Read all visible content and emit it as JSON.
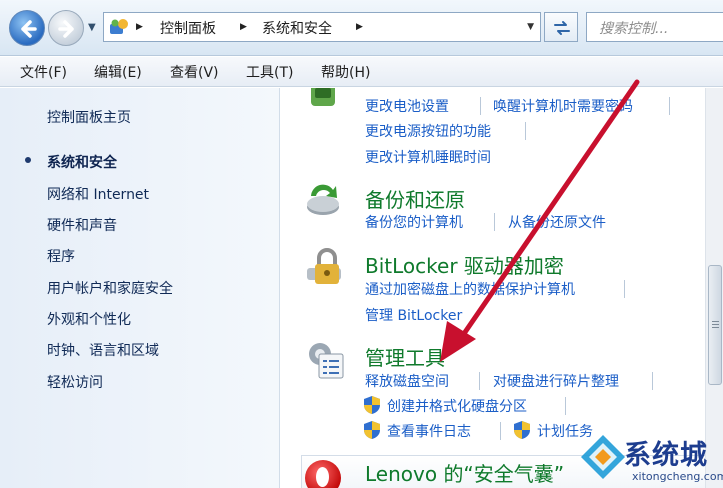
{
  "address_bar": {
    "breadcrumbs": [
      "控制面板",
      "系统和安全"
    ],
    "search_placeholder": "搜索控制..."
  },
  "menubar": [
    "文件(F)",
    "编辑(E)",
    "查看(V)",
    "工具(T)",
    "帮助(H)"
  ],
  "left_pane": {
    "home": "控制面板主页",
    "items": [
      {
        "label": "系统和安全",
        "current": true
      },
      {
        "label": "网络和 Internet",
        "current": false
      },
      {
        "label": "硬件和声音",
        "current": false
      },
      {
        "label": "程序",
        "current": false
      },
      {
        "label": "用户帐户和家庭安全",
        "current": false
      },
      {
        "label": "外观和个性化",
        "current": false
      },
      {
        "label": "时钟、语言和区域",
        "current": false
      },
      {
        "label": "轻松访问",
        "current": false
      }
    ]
  },
  "main": {
    "power": {
      "links": [
        "更改电池设置",
        "唤醒计算机时需要密码",
        "更改电源按钮的功能",
        "更改计算机睡眠时间"
      ]
    },
    "backup": {
      "title": "备份和还原",
      "links": [
        "备份您的计算机",
        "从备份还原文件"
      ]
    },
    "bitlocker": {
      "title": "BitLocker 驱动器加密",
      "links": [
        "通过加密磁盘上的数据保护计算机",
        "管理 BitLocker"
      ]
    },
    "admin_tools": {
      "title": "管理工具",
      "links": [
        "释放磁盘空间",
        "对硬盘进行碎片整理",
        "创建并格式化硬盘分区",
        "查看事件日志",
        "计划任务"
      ]
    },
    "lenovo": {
      "title": "Lenovo 的“安全气囊”"
    }
  },
  "watermark": {
    "title": "系统城",
    "url": "xitongcheng.com"
  },
  "colors": {
    "link": "#1b5ec7",
    "category_title": "#0f7a2c",
    "annotation_arrow": "#c8102e"
  }
}
